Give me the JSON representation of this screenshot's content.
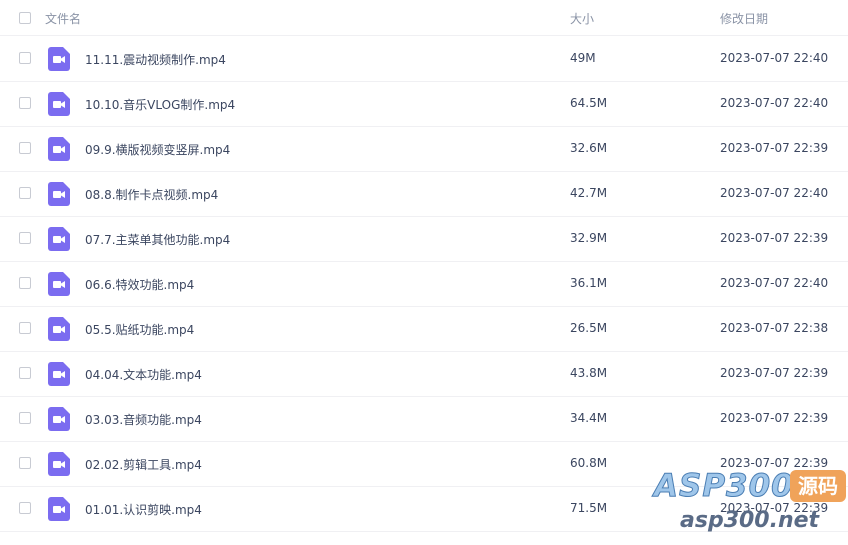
{
  "header": {
    "name_label": "文件名",
    "size_label": "大小",
    "date_label": "修改日期"
  },
  "files": [
    {
      "name": "11.11.震动视频制作.mp4",
      "size": "49M",
      "date": "2023-07-07 22:40",
      "icon": "video-file-icon"
    },
    {
      "name": "10.10.音乐VLOG制作.mp4",
      "size": "64.5M",
      "date": "2023-07-07 22:40",
      "icon": "video-file-icon"
    },
    {
      "name": "09.9.横版视频变竖屏.mp4",
      "size": "32.6M",
      "date": "2023-07-07 22:39",
      "icon": "video-file-icon"
    },
    {
      "name": "08.8.制作卡点视频.mp4",
      "size": "42.7M",
      "date": "2023-07-07 22:40",
      "icon": "video-file-icon"
    },
    {
      "name": "07.7.主菜单其他功能.mp4",
      "size": "32.9M",
      "date": "2023-07-07 22:39",
      "icon": "video-file-icon"
    },
    {
      "name": "06.6.特效功能.mp4",
      "size": "36.1M",
      "date": "2023-07-07 22:40",
      "icon": "video-file-icon"
    },
    {
      "name": "05.5.贴纸功能.mp4",
      "size": "26.5M",
      "date": "2023-07-07 22:38",
      "icon": "video-file-icon"
    },
    {
      "name": "04.04.文本功能.mp4",
      "size": "43.8M",
      "date": "2023-07-07 22:39",
      "icon": "video-file-icon"
    },
    {
      "name": "03.03.音频功能.mp4",
      "size": "34.4M",
      "date": "2023-07-07 22:39",
      "icon": "video-file-icon"
    },
    {
      "name": "02.02.剪辑工具.mp4",
      "size": "60.8M",
      "date": "2023-07-07 22:39",
      "icon": "video-file-icon"
    },
    {
      "name": "01.01.认识剪映.mp4",
      "size": "71.5M",
      "date": "2023-07-07 22:39",
      "icon": "video-file-icon"
    }
  ],
  "watermark": {
    "brand": "ASP300",
    "badge": "源码",
    "url": "asp300.net"
  },
  "colors": {
    "icon": "#7b6cf0",
    "text": "#3b4660",
    "header_text": "#8a93a6",
    "divider": "#f0f0f3"
  }
}
